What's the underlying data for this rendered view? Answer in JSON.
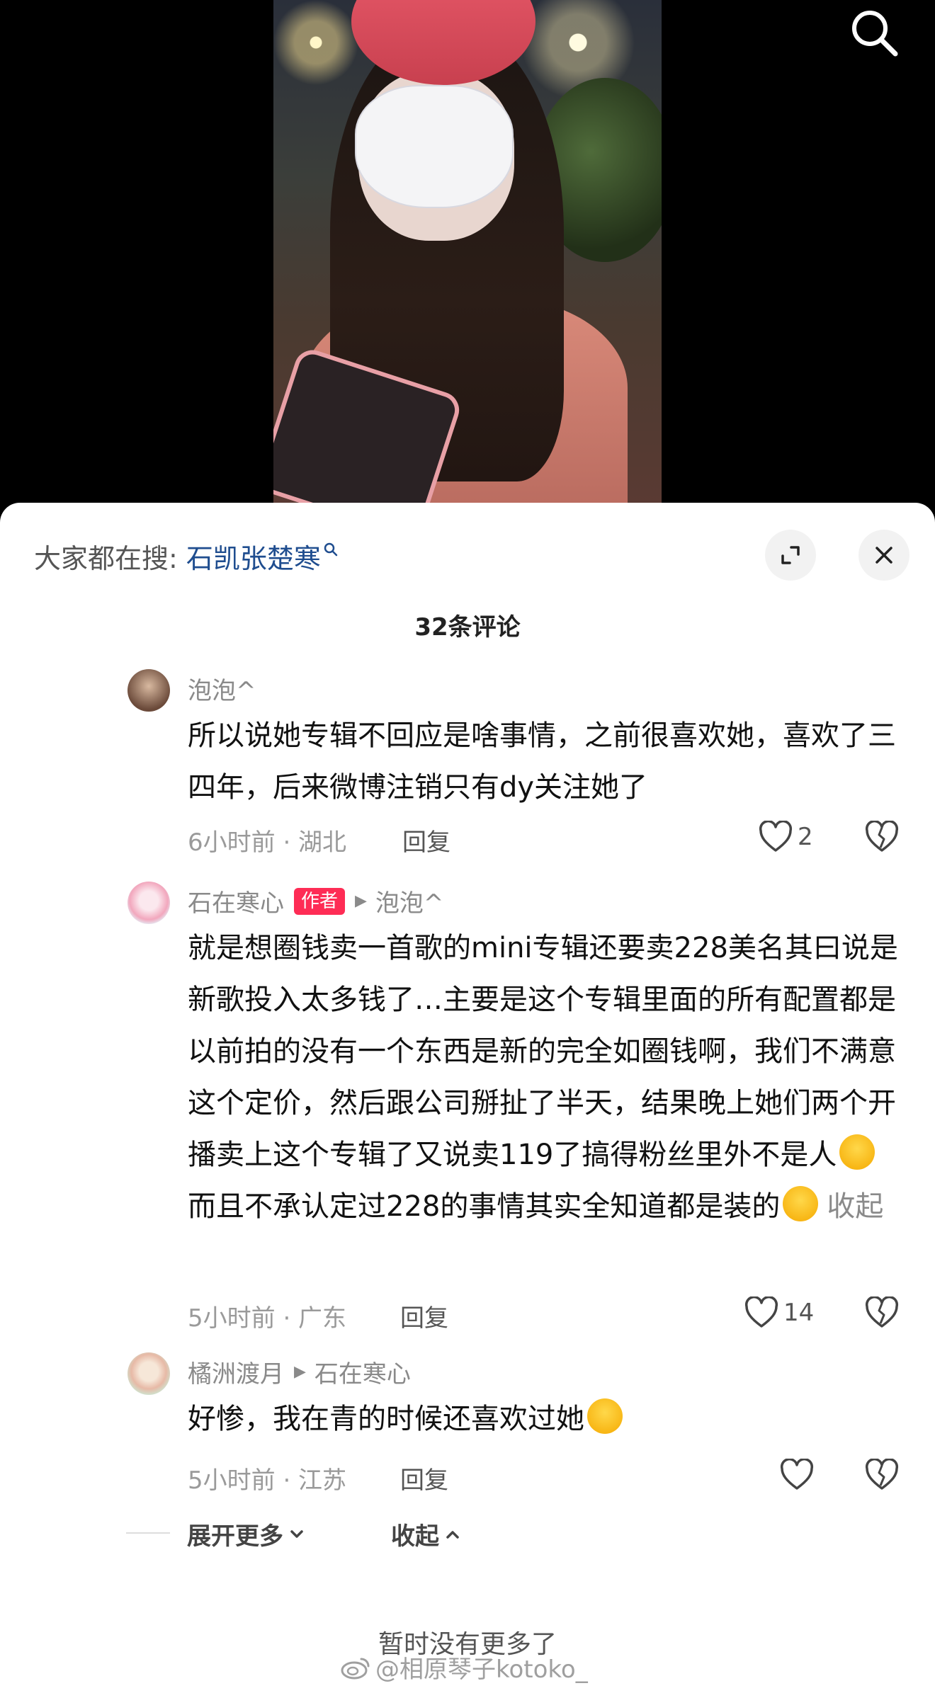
{
  "header": {
    "search_icon": "search-icon"
  },
  "search_bar": {
    "label": "大家都在搜:",
    "term": "石凯张楚寒"
  },
  "comments_count": "32条评论",
  "comments": [
    {
      "username": "泡泡^",
      "text": "所以说她专辑不回应是啥事情，之前很喜欢她，喜欢了三四年，后来微博注销只有dy关注她了",
      "time_location": "6小时前 · 湖北",
      "reply_label": "回复",
      "likes": "2"
    },
    {
      "username": "石在寒心",
      "author_tag": "作者",
      "reply_to": "泡泡^",
      "text_part1": "就是想圈钱卖一首歌的mini专辑还要卖228美名其曰说是新歌投入太多钱了…主要是这个专辑里面的所有配置都是以前拍的没有一个东西是新的完全如圈钱啊，我们不满意这个定价，然后跟公司掰扯了半天，结果晚上她们两个开播卖上这个专辑了又说卖119了搞得粉丝里外不是人",
      "text_part2": "而且不承认定过228的事情其实全知道都是装的",
      "collapse_label": "收起",
      "time_location": "5小时前 · 广东",
      "reply_label": "回复",
      "likes": "14"
    },
    {
      "username": "橘洲渡月",
      "reply_to": "石在寒心",
      "text": "好惨，我在青的时候还喜欢过她",
      "time_location": "5小时前 · 江苏",
      "reply_label": "回复"
    }
  ],
  "thread_controls": {
    "expand_more": "展开更多",
    "collapse": "收起"
  },
  "end_note": "暂时没有更多了",
  "watermark": "@相原琴子kotoko_",
  "colors": {
    "author_tag": "#fe2c55",
    "search_term": "#1f4d8f"
  }
}
